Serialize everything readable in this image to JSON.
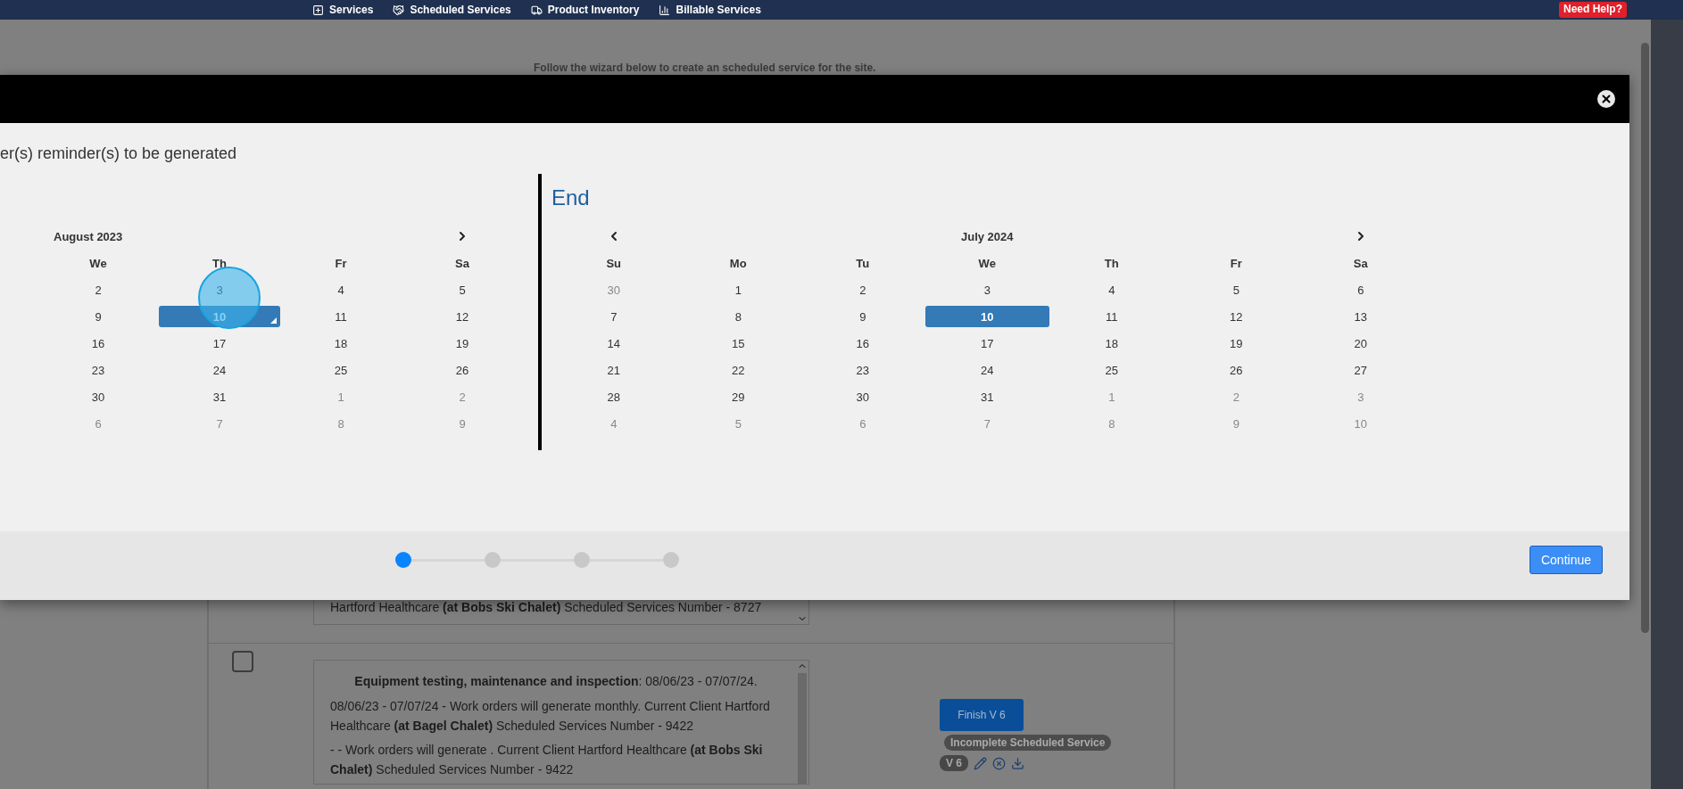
{
  "nav": {
    "items": [
      {
        "label": "Services"
      },
      {
        "label": "Scheduled Services"
      },
      {
        "label": "Product Inventory"
      },
      {
        "label": "Billable Services"
      }
    ],
    "help": "Need Help?"
  },
  "page": {
    "intro": "Follow the wizard below to create an scheduled service for the site.",
    "services": [
      {
        "paragraphs": [
          "Hartford Healthcare **(at Bobs Ski Chalet)** Scheduled Services Number - 8727"
        ]
      },
      {
        "checked": false,
        "title": "**Equipment testing, maintenance and inspection**: 08/06/23 - 07/07/24.",
        "paragraphs": [
          "08/06/23 - 07/07/24 - Work orders will generate monthly. Current Client Hartford Healthcare **(at Bagel Chalet)** Scheduled Services Number - 9422",
          "- - Work orders will generate . Current Client Hartford Healthcare **(at Bobs Ski Chalet)** Scheduled Services Number - 9422"
        ],
        "actions": {
          "button": "Finish V 6",
          "status": "Incomplete Scheduled Service",
          "version": "V 6"
        }
      }
    ]
  },
  "modal": {
    "instruction": "er(s) reminder(s) to be generated",
    "start_calendar": {
      "month": "August 2023",
      "weekdays": [
        "We",
        "Th",
        "Fr",
        "Sa"
      ],
      "rows": [
        [
          {
            "label": "2",
            "muted": false,
            "selected": false,
            "today": false
          },
          {
            "label": "3",
            "muted": false,
            "selected": false,
            "today": false
          },
          {
            "label": "4",
            "muted": false,
            "selected": false,
            "today": false
          },
          {
            "label": "5",
            "muted": false,
            "selected": false,
            "today": false
          }
        ],
        [
          {
            "label": "9",
            "muted": false,
            "selected": false,
            "today": false
          },
          {
            "label": "10",
            "muted": false,
            "selected": true,
            "today": true
          },
          {
            "label": "11",
            "muted": false,
            "selected": false,
            "today": false
          },
          {
            "label": "12",
            "muted": false,
            "selected": false,
            "today": false
          }
        ],
        [
          {
            "label": "16",
            "muted": false,
            "selected": false,
            "today": false
          },
          {
            "label": "17",
            "muted": false,
            "selected": false,
            "today": false
          },
          {
            "label": "18",
            "muted": false,
            "selected": false,
            "today": false
          },
          {
            "label": "19",
            "muted": false,
            "selected": false,
            "today": false
          }
        ],
        [
          {
            "label": "23",
            "muted": false,
            "selected": false,
            "today": false
          },
          {
            "label": "24",
            "muted": false,
            "selected": false,
            "today": false
          },
          {
            "label": "25",
            "muted": false,
            "selected": false,
            "today": false
          },
          {
            "label": "26",
            "muted": false,
            "selected": false,
            "today": false
          }
        ],
        [
          {
            "label": "30",
            "muted": false,
            "selected": false,
            "today": false
          },
          {
            "label": "31",
            "muted": false,
            "selected": false,
            "today": false
          },
          {
            "label": "1",
            "muted": true,
            "selected": false,
            "today": false
          },
          {
            "label": "2",
            "muted": true,
            "selected": false,
            "today": false
          }
        ],
        [
          {
            "label": "6",
            "muted": true,
            "selected": false,
            "today": false
          },
          {
            "label": "7",
            "muted": true,
            "selected": false,
            "today": false
          },
          {
            "label": "8",
            "muted": true,
            "selected": false,
            "today": false
          },
          {
            "label": "9",
            "muted": true,
            "selected": false,
            "today": false
          }
        ]
      ]
    },
    "end_calendar": {
      "heading": "End",
      "month": "July 2024",
      "weekdays": [
        "Su",
        "Mo",
        "Tu",
        "We",
        "Th",
        "Fr",
        "Sa"
      ],
      "rows": [
        [
          {
            "label": "30",
            "muted": true,
            "selected": false,
            "today": false
          },
          {
            "label": "1",
            "muted": false,
            "selected": false,
            "today": false
          },
          {
            "label": "2",
            "muted": false,
            "selected": false,
            "today": false
          },
          {
            "label": "3",
            "muted": false,
            "selected": false,
            "today": false
          },
          {
            "label": "4",
            "muted": false,
            "selected": false,
            "today": false
          },
          {
            "label": "5",
            "muted": false,
            "selected": false,
            "today": false
          },
          {
            "label": "6",
            "muted": false,
            "selected": false,
            "today": false
          }
        ],
        [
          {
            "label": "7",
            "muted": false,
            "selected": false,
            "today": false
          },
          {
            "label": "8",
            "muted": false,
            "selected": false,
            "today": false
          },
          {
            "label": "9",
            "muted": false,
            "selected": false,
            "today": false
          },
          {
            "label": "10",
            "muted": false,
            "selected": true,
            "today": false
          },
          {
            "label": "11",
            "muted": false,
            "selected": false,
            "today": false
          },
          {
            "label": "12",
            "muted": false,
            "selected": false,
            "today": false
          },
          {
            "label": "13",
            "muted": false,
            "selected": false,
            "today": false
          }
        ],
        [
          {
            "label": "14",
            "muted": false,
            "selected": false,
            "today": false
          },
          {
            "label": "15",
            "muted": false,
            "selected": false,
            "today": false
          },
          {
            "label": "16",
            "muted": false,
            "selected": false,
            "today": false
          },
          {
            "label": "17",
            "muted": false,
            "selected": false,
            "today": false
          },
          {
            "label": "18",
            "muted": false,
            "selected": false,
            "today": false
          },
          {
            "label": "19",
            "muted": false,
            "selected": false,
            "today": false
          },
          {
            "label": "20",
            "muted": false,
            "selected": false,
            "today": false
          }
        ],
        [
          {
            "label": "21",
            "muted": false,
            "selected": false,
            "today": false
          },
          {
            "label": "22",
            "muted": false,
            "selected": false,
            "today": false
          },
          {
            "label": "23",
            "muted": false,
            "selected": false,
            "today": false
          },
          {
            "label": "24",
            "muted": false,
            "selected": false,
            "today": false
          },
          {
            "label": "25",
            "muted": false,
            "selected": false,
            "today": false
          },
          {
            "label": "26",
            "muted": false,
            "selected": false,
            "today": false
          },
          {
            "label": "27",
            "muted": false,
            "selected": false,
            "today": false
          }
        ],
        [
          {
            "label": "28",
            "muted": false,
            "selected": false,
            "today": false
          },
          {
            "label": "29",
            "muted": false,
            "selected": false,
            "today": false
          },
          {
            "label": "30",
            "muted": false,
            "selected": false,
            "today": false
          },
          {
            "label": "31",
            "muted": false,
            "selected": false,
            "today": false
          },
          {
            "label": "1",
            "muted": true,
            "selected": false,
            "today": false
          },
          {
            "label": "2",
            "muted": true,
            "selected": false,
            "today": false
          },
          {
            "label": "3",
            "muted": true,
            "selected": false,
            "today": false
          }
        ],
        [
          {
            "label": "4",
            "muted": true,
            "selected": false,
            "today": false
          },
          {
            "label": "5",
            "muted": true,
            "selected": false,
            "today": false
          },
          {
            "label": "6",
            "muted": true,
            "selected": false,
            "today": false
          },
          {
            "label": "7",
            "muted": true,
            "selected": false,
            "today": false
          },
          {
            "label": "8",
            "muted": true,
            "selected": false,
            "today": false
          },
          {
            "label": "9",
            "muted": true,
            "selected": false,
            "today": false
          },
          {
            "label": "10",
            "muted": true,
            "selected": false,
            "today": false
          }
        ]
      ]
    },
    "steps": [
      {
        "selected": true
      },
      {
        "selected": false
      },
      {
        "selected": false
      },
      {
        "selected": false
      }
    ],
    "continue": "Continue"
  }
}
